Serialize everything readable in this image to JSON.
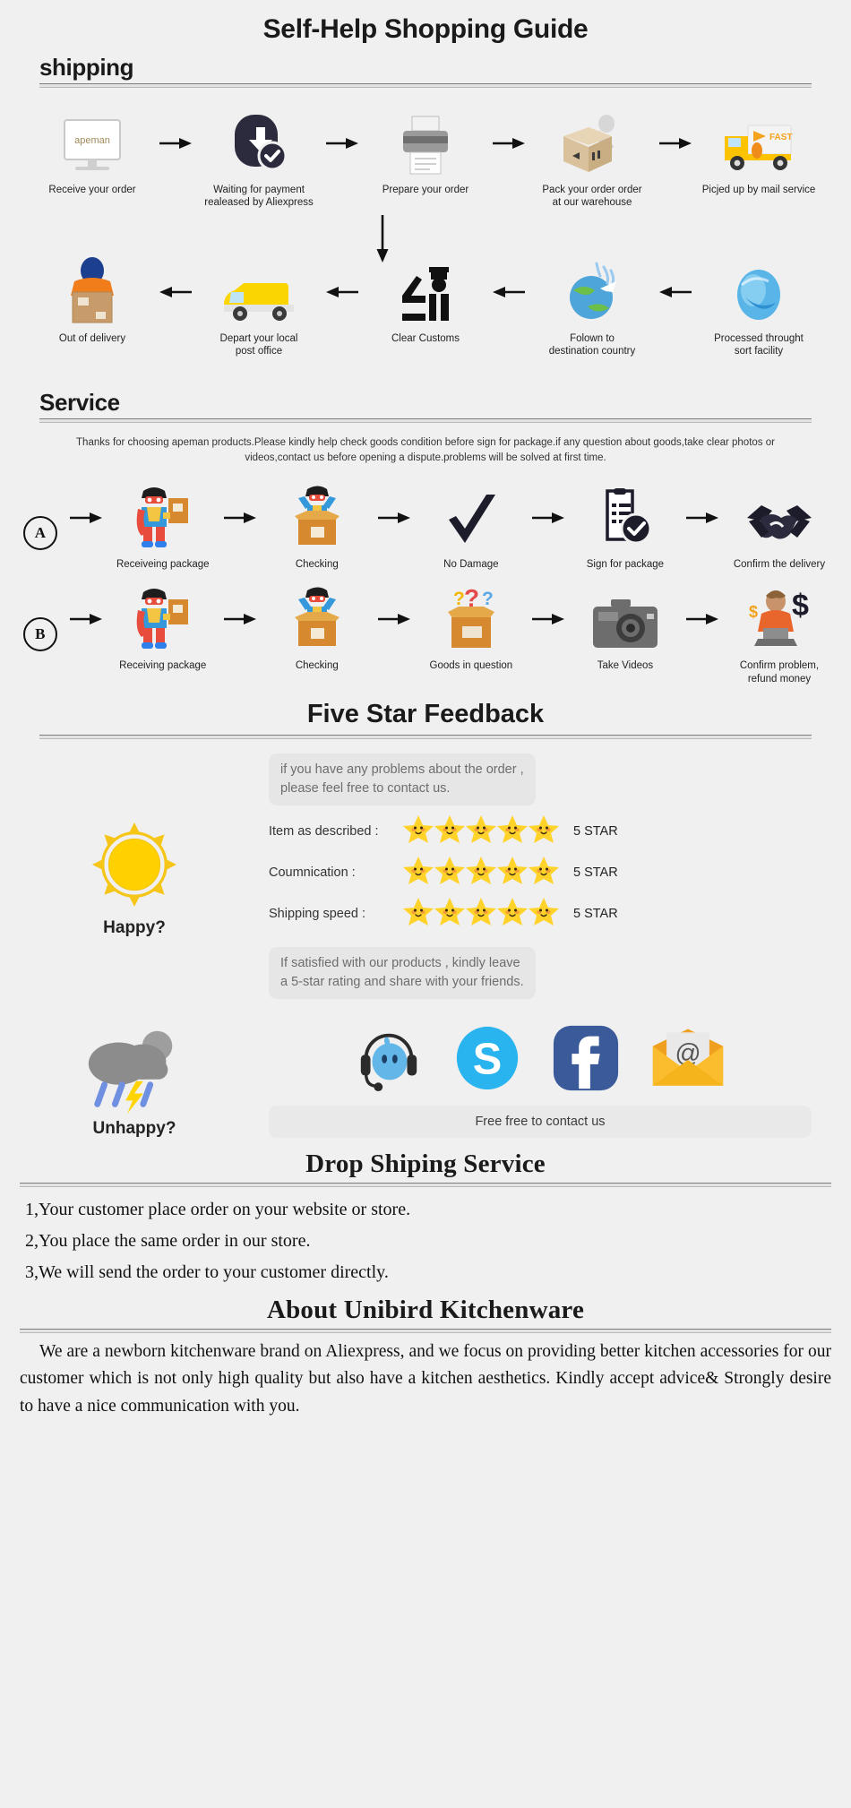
{
  "page": {
    "title": "Self-Help Shopping Guide",
    "bg": "#f0f0f0"
  },
  "shipping": {
    "heading": "shipping",
    "row1": [
      {
        "label": "Receive your order",
        "icon": "monitor-apeman-icon"
      },
      {
        "label": "Waiting for payment\nrealeased by Aliexpress",
        "icon": "payment-shield-dollar-icon"
      },
      {
        "label": "Prepare your order",
        "icon": "printer-icon"
      },
      {
        "label": "Pack your order order\nat our warehouse",
        "icon": "packing-box-worker-icon"
      },
      {
        "label": "Picjed up by mail service",
        "icon": "fast-delivery-truck-icon"
      }
    ],
    "row2": [
      {
        "label": "Out of delivery",
        "icon": "courier-carrying-box-icon"
      },
      {
        "label": "Depart your local\npost office",
        "icon": "yellow-van-icon"
      },
      {
        "label": "Clear Customs",
        "icon": "customs-officer-icon"
      },
      {
        "label": "Folown to\ndestination country",
        "icon": "globe-airplane-icon"
      },
      {
        "label": "Processed throught\nsort facility",
        "icon": "blue-globe-icon"
      }
    ]
  },
  "service": {
    "heading": "Service",
    "note": "Thanks for choosing apeman products.Please kindly help check goods condition before sign for package.if any question about goods,take clear photos or videos,contact us before opening a dispute.problems will be solved at first time.",
    "rowA": {
      "badge": "A",
      "steps": [
        {
          "label": "Receiveing package",
          "icon": "hero-holding-parcel-icon"
        },
        {
          "label": "Checking",
          "icon": "hero-in-open-box-icon"
        },
        {
          "label": "No Damage",
          "icon": "checkmark-icon"
        },
        {
          "label": "Sign for package",
          "icon": "signed-document-icon"
        },
        {
          "label": "Confirm the delivery",
          "icon": "handshake-icon"
        }
      ]
    },
    "rowB": {
      "badge": "B",
      "steps": [
        {
          "label": "Receiving package",
          "icon": "hero-holding-parcel-icon"
        },
        {
          "label": "Checking",
          "icon": "hero-in-open-box-icon"
        },
        {
          "label": "Goods in question",
          "icon": "box-question-marks-icon"
        },
        {
          "label": "Take Videos",
          "icon": "camera-icon"
        },
        {
          "label": "Confirm problem,\nrefund money",
          "icon": "refund-money-icon"
        }
      ]
    }
  },
  "feedback": {
    "heading": "Five Star Feedback",
    "top_bubble": "if you have any problems about the order ,\nplease feel free to contact us.",
    "bottom_bubble": "If satisfied with our products ,  kindly leave\na 5-star rating and share with your friends.",
    "happy_label": "Happy?",
    "happy_icon": "sun-icon",
    "ratings": [
      {
        "label": "Item as described :",
        "stars": 5,
        "value": "5 STAR"
      },
      {
        "label": "Coumnication :",
        "stars": 5,
        "value": "5 STAR"
      },
      {
        "label": "Shipping speed :",
        "stars": 5,
        "value": "5 STAR"
      }
    ],
    "star_color": "#ffd32a"
  },
  "contact": {
    "unhappy_label": "Unhappy?",
    "unhappy_icon": "rain-cloud-lightning-icon",
    "button_label": "Free free to contact us",
    "icons": [
      {
        "name": "headset-chat-icon",
        "color": "#5ea9dd"
      },
      {
        "name": "skype-icon",
        "color": "#00aff0"
      },
      {
        "name": "facebook-icon",
        "color": "#3b5998"
      },
      {
        "name": "email-envelope-icon",
        "color": "#ffc321"
      }
    ]
  },
  "dropshipping": {
    "heading": "Drop Shiping Service",
    "lines": [
      "1,Your customer place order on your website or store.",
      "2,You place the same order in our store.",
      "3,We will send the order to your customer directly."
    ]
  },
  "about": {
    "heading": "About Unibird Kitchenware",
    "paragraph": "We are a newborn kitchenware brand on Aliexpress, and we focus on providing better kitchen accessories for our customer which is not only high quality but also have a kitchen aesthetics. Kindly accept advice& Strongly desire to have a nice communication with you."
  }
}
